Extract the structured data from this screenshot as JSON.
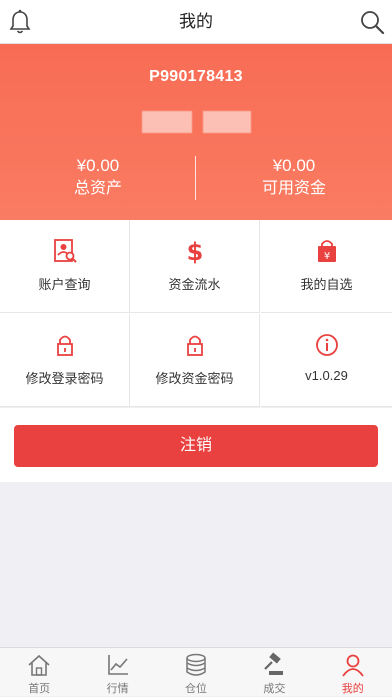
{
  "header": {
    "title": "我的",
    "left_icon": "bell-icon",
    "right_icon": "search-icon"
  },
  "account": {
    "id": "P990178413",
    "total_assets": {
      "value": "¥0.00",
      "label": "总资产"
    },
    "available_funds": {
      "value": "¥0.00",
      "label": "可用资金"
    }
  },
  "menu": [
    {
      "label": "账户查询",
      "icon": "account-query-icon"
    },
    {
      "label": "资金流水",
      "icon": "dollar-icon"
    },
    {
      "label": "我的自选",
      "icon": "favorites-bag-icon"
    },
    {
      "label": "修改登录密码",
      "icon": "lock-icon"
    },
    {
      "label": "修改资金密码",
      "icon": "lock-icon"
    },
    {
      "label": "v1.0.29",
      "icon": "info-icon"
    }
  ],
  "logout_label": "注销",
  "tabs": [
    {
      "label": "首页",
      "icon": "home-icon"
    },
    {
      "label": "行情",
      "icon": "chart-icon"
    },
    {
      "label": "仓位",
      "icon": "coins-icon"
    },
    {
      "label": "成交",
      "icon": "gavel-icon"
    },
    {
      "label": "我的",
      "icon": "person-icon",
      "active": true
    }
  ],
  "colors": {
    "accent": "#e9413f",
    "hero_gradient_top": "#f86c55",
    "hero_gradient_bottom": "#f97c62"
  }
}
